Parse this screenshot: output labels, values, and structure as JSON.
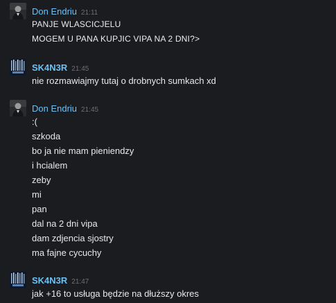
{
  "messages": [
    {
      "author": "Don Endriu",
      "time": "21:11",
      "lines": [
        "PANJE WLASCICJELU",
        "MOGEM U PANA KUPJIC VIPA NA 2 DNI?>"
      ]
    },
    {
      "author": "SK4N3R",
      "time": "21:45",
      "lines": [
        "nie rozmawiajmy tutaj o drobnych sumkach xd"
      ]
    },
    {
      "author": "Don Endriu",
      "time": "21:45",
      "lines": [
        ":(",
        "szkoda",
        "bo ja nie mam pieniendzy",
        "i hcialem",
        "zeby",
        "mi",
        "pan",
        "dal na 2 dni vipa",
        "dam zdjencia sjostry",
        "ma fajne cycuchy"
      ]
    },
    {
      "author": "SK4N3R",
      "time": "21:47",
      "lines": [
        "jak +16 to usługa będzie na dłuższy okres"
      ]
    }
  ],
  "colors": {
    "background": "#1b1c20",
    "author": "#6bc1f5",
    "timestamp": "#6d6f73",
    "text": "#e8e8e8"
  }
}
